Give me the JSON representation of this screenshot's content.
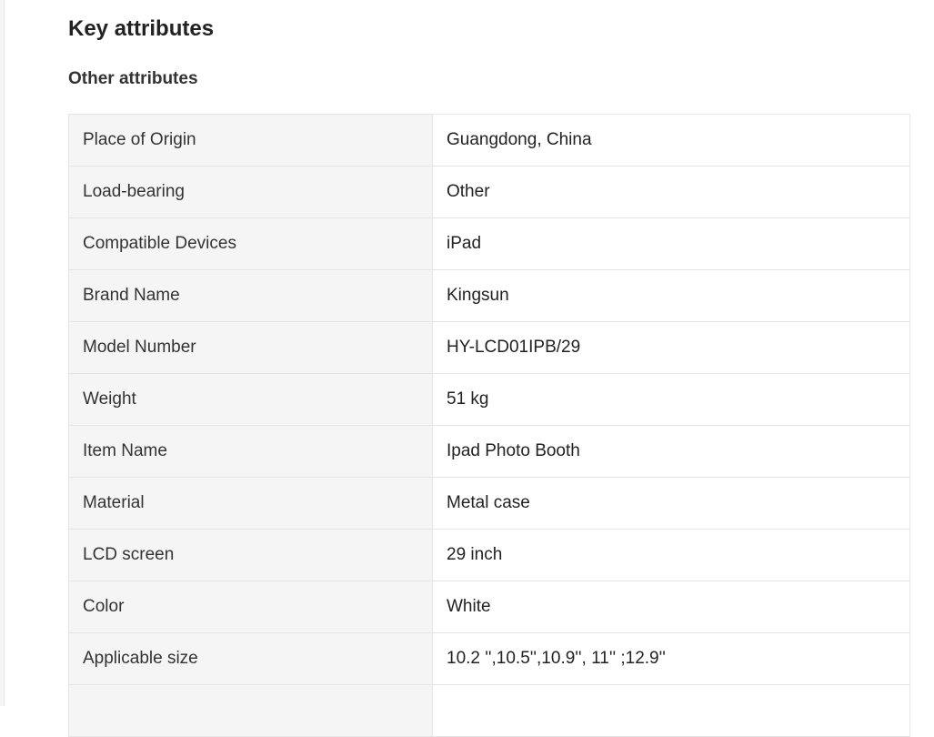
{
  "section": {
    "title": "Key attributes",
    "subtitle": "Other attributes"
  },
  "attributes": [
    {
      "key": "Place of Origin",
      "value": "Guangdong, China"
    },
    {
      "key": "Load-bearing",
      "value": "Other"
    },
    {
      "key": "Compatible Devices",
      "value": "iPad"
    },
    {
      "key": "Brand Name",
      "value": "Kingsun"
    },
    {
      "key": "Model Number",
      "value": "HY-LCD01IPB/29"
    },
    {
      "key": "Weight",
      "value": "51 kg"
    },
    {
      "key": "Item Name",
      "value": "Ipad Photo Booth"
    },
    {
      "key": "Material",
      "value": "Metal case"
    },
    {
      "key": "LCD screen",
      "value": "29 inch"
    },
    {
      "key": "Color",
      "value": "White"
    },
    {
      "key": "Applicable size",
      "value": "10.2 '',10.5'',10.9'', 11'' ;12.9''"
    },
    {
      "key": "",
      "value": ""
    }
  ]
}
